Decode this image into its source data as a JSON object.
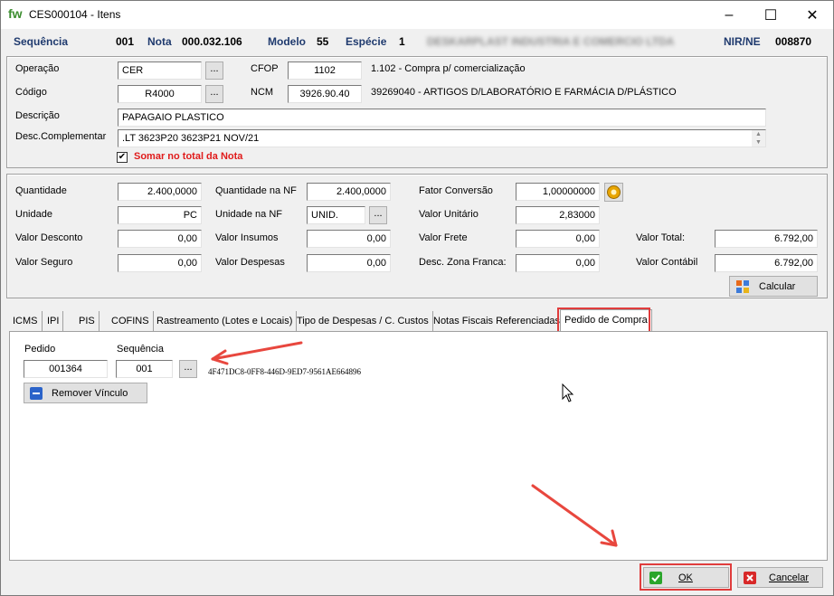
{
  "window": {
    "app_icon": "fw",
    "title": "CES000104 -  Itens",
    "controls": {
      "minimize": "–",
      "maximize": "☐",
      "close": "✕"
    }
  },
  "header": {
    "seq_label": "Sequência",
    "seq_value": "001",
    "nota_label": "Nota",
    "nota_value": "000.032.106",
    "modelo_label": "Modelo",
    "modelo_value": "55",
    "especie_label": "Espécie",
    "especie_value": "1",
    "company_blurred": "DESKARPLAST INDUSTRIA E COMERCIO LTDA",
    "nir_label": "NIR/NE",
    "nir_value": "008870"
  },
  "product": {
    "operacao_label": "Operação",
    "operacao_value": "CER",
    "cfop_label": "CFOP",
    "cfop_value": "1102",
    "cfop_desc": "1.102 - Compra p/ comercialização",
    "codigo_label": "Código",
    "codigo_value": "R4000",
    "ncm_label": "NCM",
    "ncm_value": "3926.90.40",
    "ncm_desc": "39269040 - ARTIGOS D/LABORATÓRIO E FARMÁCIA D/PLÁSTICO",
    "descricao_label": "Descrição",
    "descricao_value": "PAPAGAIO PLASTICO",
    "desc_compl_label": "Desc.Complementar",
    "desc_compl_value": ".LT 3623P20 3623P21 NOV/21",
    "somar_label": "Somar no total da Nota",
    "somar_checked": "✔",
    "dots": "..."
  },
  "values": {
    "quantidade_label": "Quantidade",
    "quantidade_value": "2.400,0000",
    "qtd_nf_label": "Quantidade na NF",
    "qtd_nf_value": "2.400,0000",
    "fator_label": "Fator Conversão",
    "fator_value": "1,00000000",
    "unidade_label": "Unidade",
    "unidade_value": "PC",
    "unid_nf_label": "Unidade na NF",
    "unid_nf_value": "UNID.",
    "valor_unit_label": "Valor Unitário",
    "valor_unit_value": "2,83000",
    "desconto_label": "Valor Desconto",
    "desconto_value": "0,00",
    "insumos_label": "Valor Insumos",
    "insumos_value": "0,00",
    "frete_label": "Valor Frete",
    "frete_value": "0,00",
    "total_label": "Valor Total:",
    "total_value": "6.792,00",
    "seguro_label": "Valor Seguro",
    "seguro_value": "0,00",
    "despesas_label": "Valor Despesas",
    "despesas_value": "0,00",
    "zona_franca_label": "Desc. Zona Franca:",
    "zona_franca_value": "0,00",
    "contabil_label": "Valor Contábil",
    "contabil_value": "6.792,00",
    "calcular_label": "Calcular"
  },
  "tabs": [
    "ICMS",
    "IPI",
    "PIS",
    "COFINS",
    "Rastreamento (Lotes e Locais)",
    "Tipo de Despesas / C. Custos",
    "Notas Fiscais Referenciadas",
    "Pedido de Compra"
  ],
  "pedido": {
    "pedido_label": "Pedido",
    "pedido_value": "001364",
    "sequencia_label": "Sequência",
    "sequencia_value": "001",
    "guid": "4F471DC8-0FF8-446D-9ED7-9561AE664896",
    "remover_label": "Remover Vínculo"
  },
  "footer": {
    "ok_label": "OK",
    "cancel_label": "Cancelar"
  },
  "colors": {
    "header_label": "#1f3a6e",
    "somar_red": "#e01b1b",
    "annotation_red": "#e8473e"
  }
}
